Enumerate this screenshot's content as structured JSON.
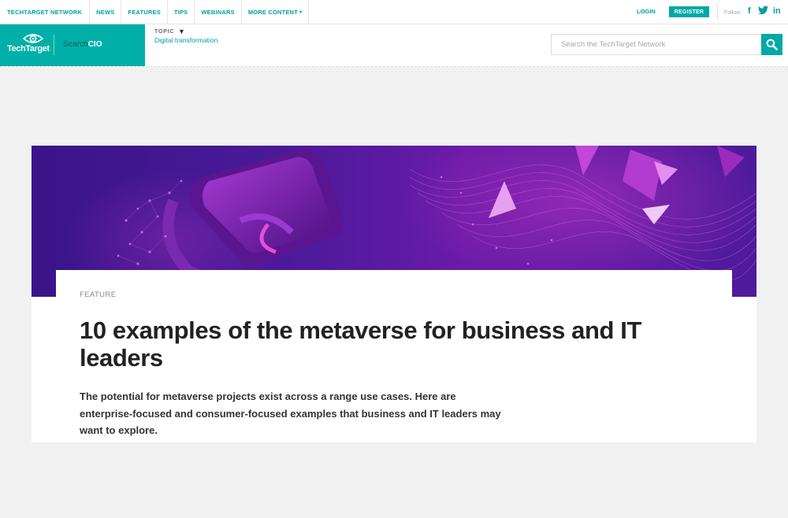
{
  "topnav": {
    "network": "TECHTARGET NETWORK",
    "news": "NEWS",
    "features": "FEATURES",
    "tips": "TIPS",
    "webinars": "WEBINARS",
    "more": "MORE CONTENT",
    "more_caret": "▾"
  },
  "account": {
    "login": "LOGIN",
    "register": "REGISTER",
    "follow": "Follow:",
    "social": [
      "f",
      "t",
      "in"
    ]
  },
  "brand": {
    "logo_text": "TechTarget",
    "site_prefix": "Search",
    "site_name": "CIO",
    "accent_color": "#00b0a8"
  },
  "topic": {
    "label": "TOPIC",
    "arrow": "▼",
    "value": "Digital transformation"
  },
  "search": {
    "placeholder": "Search the TechTarget Network",
    "icon": "search-icon"
  },
  "article": {
    "kicker": "FEATURE",
    "title": "10 examples of the metaverse for business and IT leaders",
    "summary": "The potential for metaverse projects exist across a range use cases. Here are enterprise-focused and consumer-focused examples that business and IT leaders may want to explore."
  }
}
